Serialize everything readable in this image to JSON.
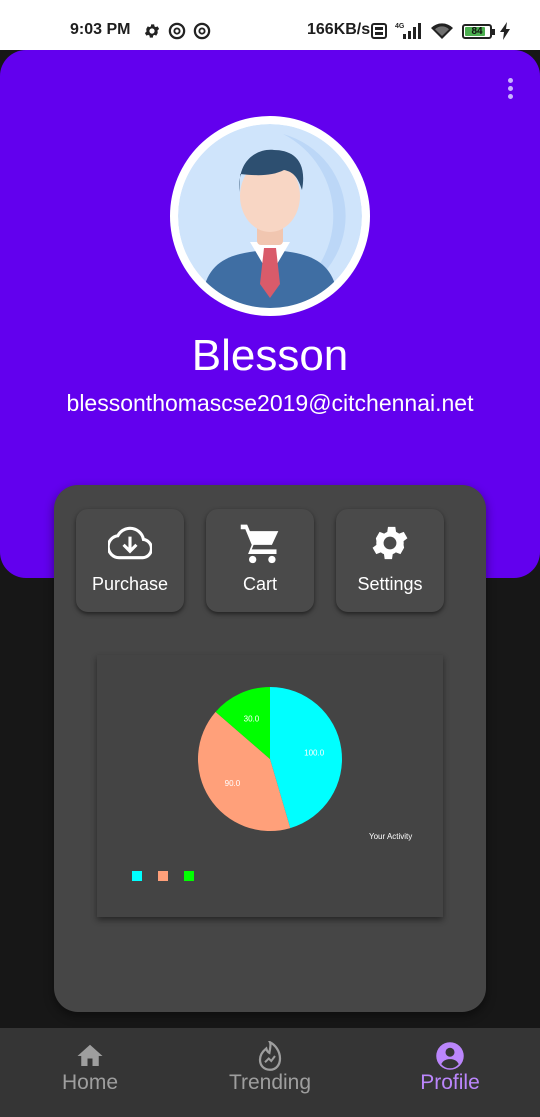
{
  "status_bar": {
    "time": "9:03 PM",
    "network_speed": "166KB/s",
    "battery_level": "84",
    "battery_fraction": 0.84,
    "icons": [
      "gear-icon",
      "at-icon",
      "at-icon",
      "volte-icon",
      "signal-icon",
      "wifi-icon",
      "battery-icon",
      "charging-icon"
    ]
  },
  "profile": {
    "name": "Blesson",
    "email": "blessonthomascse2019@citchennai.net",
    "menu_icon": "more-vert-icon"
  },
  "actions": [
    {
      "label": "Purchase",
      "icon": "cloud-download-icon"
    },
    {
      "label": "Cart",
      "icon": "cart-icon"
    },
    {
      "label": "Settings",
      "icon": "settings-icon"
    }
  ],
  "chart_data": {
    "type": "pie",
    "title": "",
    "description": "Your Activity",
    "slices": [
      {
        "label": "100.0",
        "value": 100.0,
        "color": "#00ffff"
      },
      {
        "label": "90.0",
        "value": 90.0,
        "color": "#ffa07a"
      },
      {
        "label": "30.0",
        "value": 30.0,
        "color": "#00ff00"
      }
    ],
    "legend_placement": "bottom-left"
  },
  "bottom_nav": {
    "items": [
      {
        "label": "Home",
        "icon": "home-icon",
        "active": false
      },
      {
        "label": "Trending",
        "icon": "trending-icon",
        "active": false
      },
      {
        "label": "Profile",
        "icon": "account-circle-icon",
        "active": true
      }
    ],
    "active_color": "#bb86fc",
    "inactive_color": "#9e9e9e"
  },
  "colors": {
    "primary": "#6200ee",
    "card": "#464646",
    "background": "#171717"
  }
}
